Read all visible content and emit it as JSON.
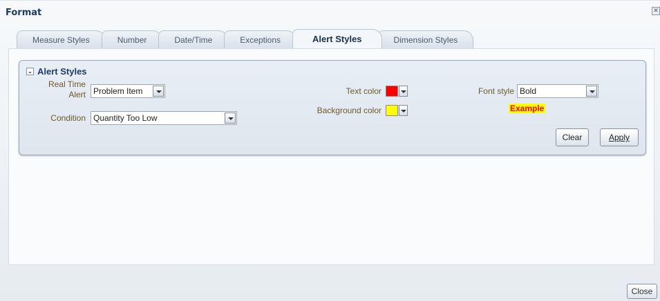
{
  "dialog": {
    "title": "Format",
    "close_glyph": "✕"
  },
  "tabs": [
    {
      "label": "Measure Styles"
    },
    {
      "label": "Number"
    },
    {
      "label": "Date/Time"
    },
    {
      "label": "Exceptions"
    },
    {
      "label": "Alert Styles",
      "active": true
    },
    {
      "label": "Dimension Styles"
    }
  ],
  "alert_styles": {
    "header": "Alert Styles",
    "toggle_glyph": "⌄",
    "real_time_alert_label_1": "Real Time",
    "real_time_alert_label_2": "Alert",
    "real_time_alert_value": "Problem Item",
    "condition_label": "Condition",
    "condition_value": "Quantity Too Low",
    "text_color_label": "Text color",
    "text_color_value": "#ff0000",
    "background_color_label": "Background color",
    "background_color_value": "#ffff00",
    "font_style_label": "Font style",
    "font_style_value": "Bold",
    "example_text": "Example",
    "clear_label": "Clear",
    "apply_label": "Apply"
  },
  "footer": {
    "close_label": "Close"
  },
  "icons": [
    "close-icon",
    "collapse-icon",
    "dropdown-arrow-icon"
  ]
}
